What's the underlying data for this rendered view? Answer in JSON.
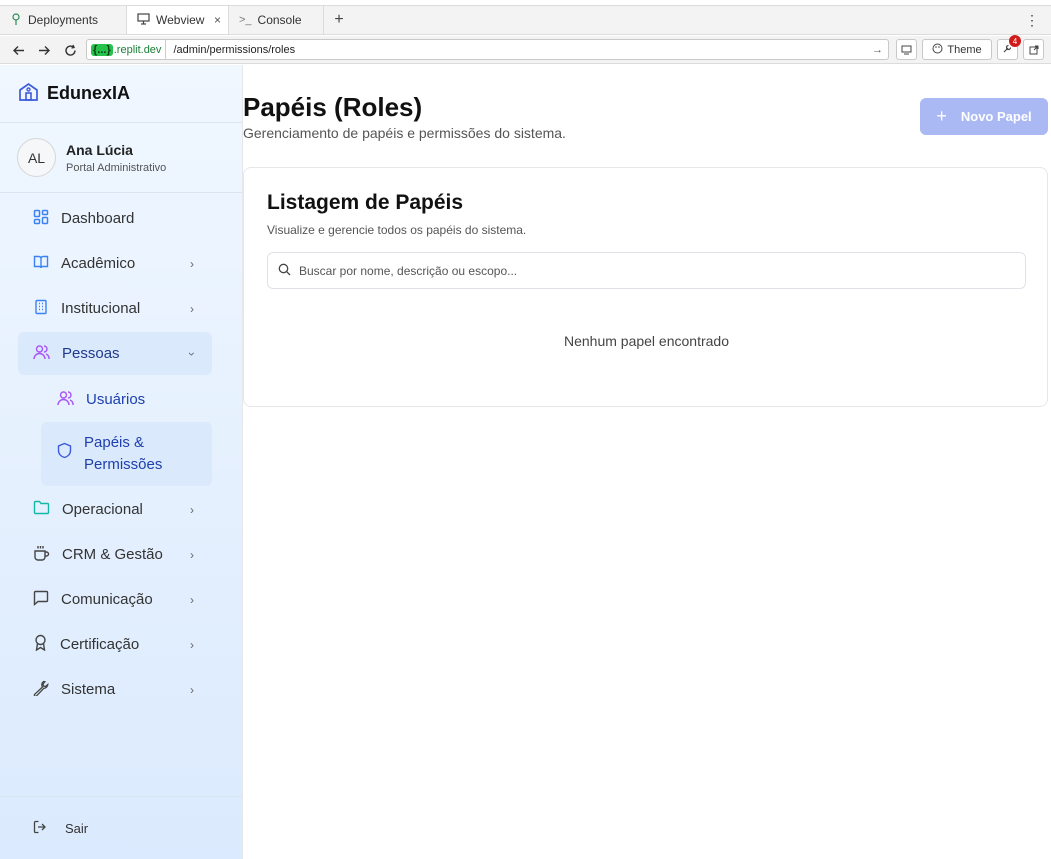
{
  "browser": {
    "tabs": [
      {
        "label": "Deployments",
        "icon": "tree-icon"
      },
      {
        "label": "Webview",
        "icon": "monitor-icon",
        "close": "×"
      },
      {
        "label": "Console",
        "icon": "terminal-icon"
      }
    ],
    "add_tab": "+",
    "menu": "⋮",
    "url_host_pill": "{...}",
    "url_host": ".replit.dev",
    "url_path": "/admin/permissions/roles",
    "theme_label": "Theme",
    "notification_count": "4"
  },
  "sidebar": {
    "brand": "EdunexIA",
    "user": {
      "initials": "AL",
      "name": "Ana Lúcia",
      "role": "Portal Administrativo"
    },
    "items": [
      {
        "label": "Dashboard",
        "icon": "dashboard-icon",
        "has_chevron": false
      },
      {
        "label": "Acadêmico",
        "icon": "book-icon",
        "has_chevron": true
      },
      {
        "label": "Institucional",
        "icon": "building-icon",
        "has_chevron": true
      },
      {
        "label": "Pessoas",
        "icon": "users-icon",
        "has_chevron": true,
        "expanded": true
      },
      {
        "label": "Operacional",
        "icon": "folder-icon",
        "has_chevron": true
      },
      {
        "label": "CRM & Gestão",
        "icon": "coffee-icon",
        "has_chevron": true
      },
      {
        "label": "Comunicação",
        "icon": "message-icon",
        "has_chevron": true
      },
      {
        "label": "Certificação",
        "icon": "award-icon",
        "has_chevron": true
      },
      {
        "label": "Sistema",
        "icon": "wrench-icon",
        "has_chevron": true
      }
    ],
    "subitems": [
      {
        "label": "Usuários",
        "icon": "users-icon"
      },
      {
        "label_line1": "Papéis &",
        "label_line2": "Permissões",
        "icon": "shield-icon",
        "active": true
      }
    ],
    "logout": "Sair"
  },
  "main": {
    "title": "Papéis (Roles)",
    "subtitle": "Gerenciamento de papéis e permissões do sistema.",
    "new_button": "Novo Papel",
    "card": {
      "title": "Listagem de Papéis",
      "subtitle": "Visualize e gerencie todos os papéis do sistema.",
      "search_placeholder": "Buscar por nome, descrição ou escopo...",
      "empty_text": "Nenhum papel encontrado"
    }
  },
  "colors": {
    "accent": "#2563eb",
    "button_disabled": "#aab9f3",
    "sidebar_active": "#dbe9fd",
    "purple_icon": "#a855f7",
    "teal_icon": "#14b8a6"
  }
}
